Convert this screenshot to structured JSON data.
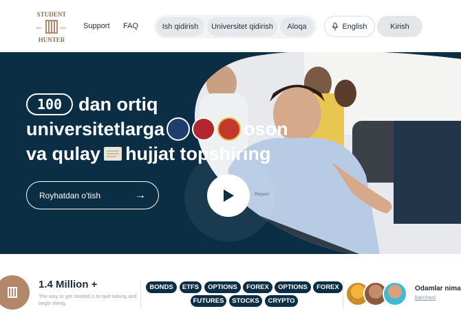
{
  "brand": {
    "logo_top": "STUDENT",
    "logo_bottom": "HUNTER",
    "logo_left_year": "EST.",
    "logo_right_year": "2023"
  },
  "header": {
    "links": [
      {
        "label": "Support"
      },
      {
        "label": "FAQ"
      }
    ],
    "pills": [
      {
        "label": "Ish qidirish"
      },
      {
        "label": "Universitet qidirish"
      },
      {
        "label": "Aloqa"
      }
    ],
    "language": "English",
    "login": "Kirish"
  },
  "hero": {
    "count": "100",
    "line1_rest": "dan ortiq",
    "line2_start": "universitetlarga",
    "line2_end": "oson",
    "line3_start": "va qulay",
    "line3_end": "hujjat topshiring",
    "signup_label": "Royhatdan o'tish",
    "tshirt_text": "Report"
  },
  "stats": {
    "number": "1.4 Million +",
    "subtitle": "The way to get started is to quit talking and begin doing.",
    "tags_row1": [
      "BONDS",
      "ETFS",
      "OPTIONS",
      "FOREX",
      "OPTIONS",
      "FOREX"
    ],
    "tags_row2": [
      "FUTURES",
      "STOCKS",
      "CRYPTO"
    ],
    "people_title": "Odamlar nima",
    "people_link": "barchasi"
  },
  "colors": {
    "hero_bg": "#0b2e45",
    "blob": "#d9dde3",
    "accent_logo": "#b2876a"
  },
  "icons": [
    "microphone-icon",
    "arrow-right-icon",
    "play-icon",
    "document-icon"
  ]
}
